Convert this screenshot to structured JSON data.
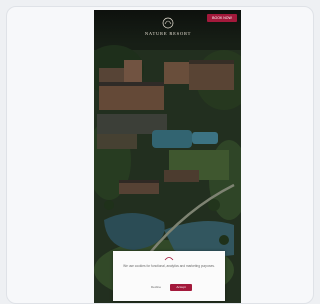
{
  "header": {
    "logo_text": "NATURE RESORT",
    "book_button": "BOOK NOW"
  },
  "consent": {
    "text": "We use cookies for functional, analytics and marketing purposes.",
    "decline_button": "Decline",
    "accept_button": "Accept"
  },
  "colors": {
    "accent": "#a3193b",
    "background": "#eef0f3"
  }
}
